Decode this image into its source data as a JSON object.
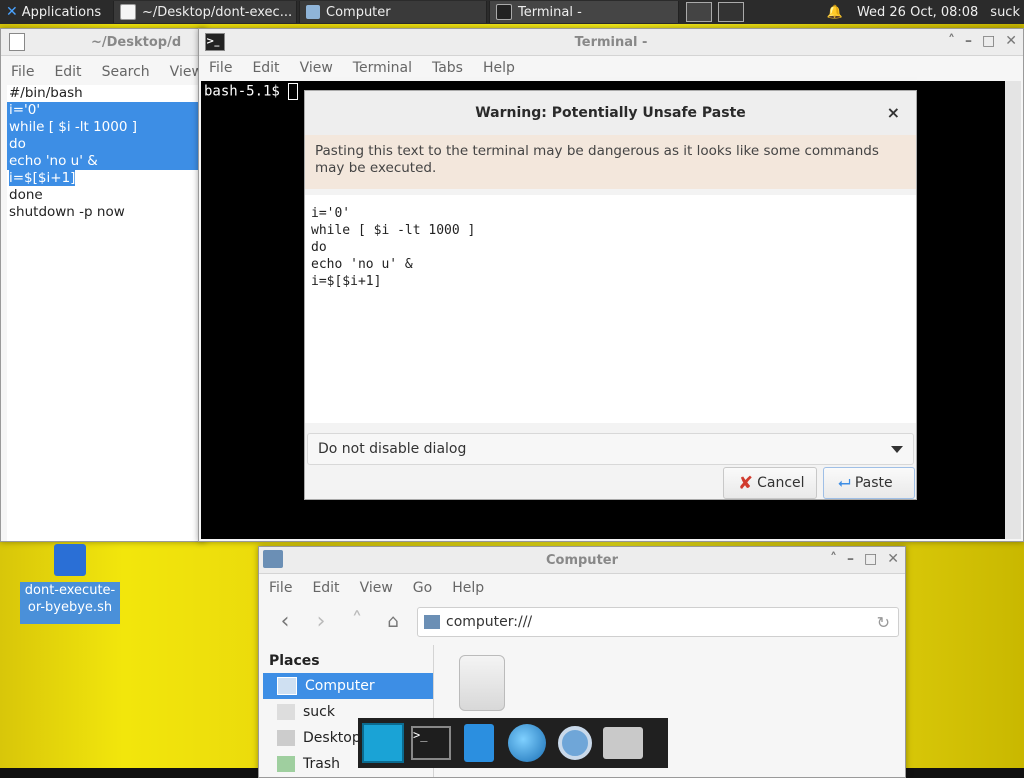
{
  "top_panel": {
    "applications_label": "Applications",
    "tasks": [
      "~/Desktop/dont-exec...",
      "Computer",
      "Terminal -"
    ],
    "clock": "Wed 26 Oct, 08:08",
    "user": "suck"
  },
  "editor": {
    "title": "~/Desktop/d",
    "menu": [
      "File",
      "Edit",
      "Search",
      "View"
    ],
    "lines": [
      {
        "text": "#/bin/bash",
        "selected": false
      },
      {
        "text": "i='0'",
        "selected": true
      },
      {
        "text": "while [ $i -lt 1000 ]",
        "selected": true
      },
      {
        "text": "do",
        "selected": true
      },
      {
        "text": "echo 'no u' &",
        "selected": true
      },
      {
        "text": "i=$[$i+1]",
        "selected": true
      },
      {
        "text": "done",
        "selected": false
      },
      {
        "text": "shutdown -p now",
        "selected": false
      }
    ]
  },
  "terminal": {
    "title": "Terminal -",
    "menu": [
      "File",
      "Edit",
      "View",
      "Terminal",
      "Tabs",
      "Help"
    ],
    "prompt": "bash-5.1$"
  },
  "dialog": {
    "title": "Warning: Potentially Unsafe Paste",
    "close_glyph": "×",
    "warning": "Pasting this text to the terminal may be dangerous as it looks like some commands may be executed.",
    "paste_lines": [
      "i='0'",
      "while [ $i -lt 1000 ]",
      "do",
      "echo 'no u' &",
      "i=$[$i+1]"
    ],
    "select_value": "Do not disable dialog",
    "cancel_label": "Cancel",
    "paste_label": "Paste"
  },
  "desktop_icon": {
    "label_line1": "dont-execute-",
    "label_line2": "or-byebye.sh"
  },
  "file_manager": {
    "title": "Computer",
    "menu": [
      "File",
      "Edit",
      "View",
      "Go",
      "Help"
    ],
    "location": "computer:///",
    "places_header": "Places",
    "places": [
      "Computer",
      "suck",
      "Desktop",
      "Trash"
    ]
  },
  "colors": {
    "selection": "#3d8ee5",
    "panel": "#2b2b2b",
    "wallpaper": "#f2e60c"
  }
}
